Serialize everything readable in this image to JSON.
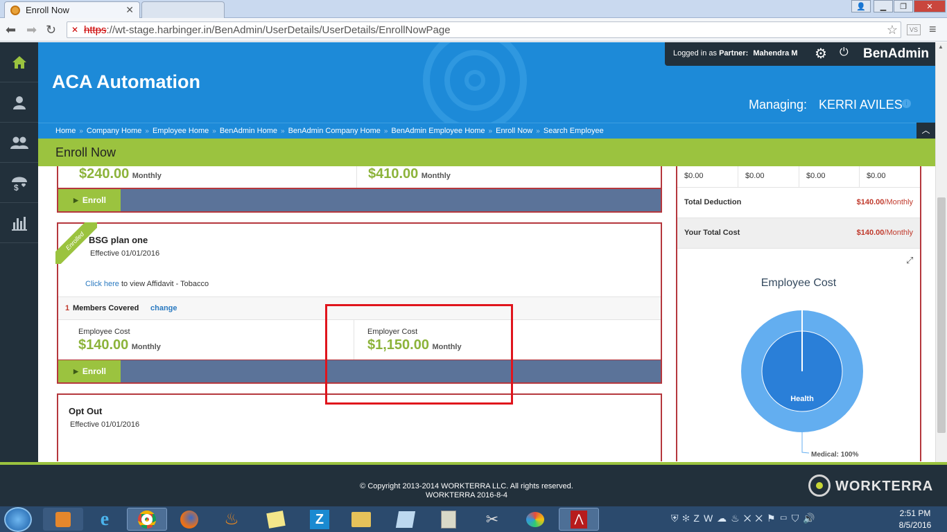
{
  "browser": {
    "tab_title": "Enroll Now",
    "url_prefix": "https",
    "url_rest": "://wt-stage.harbinger.in/BenAdmin/UserDetails/UserDetails/EnrollNowPage"
  },
  "header": {
    "logged_in_prefix": "Logged in as",
    "partner_label": "Partner:",
    "user_name": "Mahendra M",
    "app_name": "BenAdmin",
    "company": "ACA Automation",
    "managing_label": "Managing:",
    "managing_name": "KERRI AVILES"
  },
  "breadcrumbs": [
    "Home",
    "Company Home",
    "Employee Home",
    "BenAdmin Home",
    "BenAdmin Company Home",
    "BenAdmin Employee Home",
    "Enroll Now",
    "Search Employee"
  ],
  "page_title": "Enroll Now",
  "plans": {
    "top_employee_cost": "$240.00",
    "top_employer_cost": "$410.00",
    "monthly": "Monthly",
    "enroll_label": "Enroll",
    "enrolled_ribbon": "Enrolled",
    "plan_name": "BSG plan one",
    "effective": "Effective 01/01/2016",
    "click_here": "Click here",
    "affidavit_text": "to view Affidavit - Tobacco",
    "members_count": "1",
    "members_label": "Members Covered",
    "change_label": "change",
    "employee_cost_label": "Employee Cost",
    "employee_cost": "$140.00",
    "employer_cost_label": "Employer Cost",
    "employer_cost": "$1,150.00",
    "optout_title": "Opt Out",
    "optout_effective": "Effective 01/01/2016"
  },
  "summary": {
    "zero_values": [
      "$0.00",
      "$0.00",
      "$0.00",
      "$0.00"
    ],
    "total_deduction_label": "Total Deduction",
    "total_deduction_value": "$140.00",
    "your_total_cost_label": "Your Total Cost",
    "your_total_cost_value": "$140.00",
    "per_monthly": "/Monthly",
    "chart_title": "Employee Cost",
    "inner_label": "Health",
    "outer_label": "Medical: 100%"
  },
  "chart_data": {
    "type": "pie",
    "title": "Employee Cost",
    "inner": [
      {
        "label": "Health",
        "value": 100
      }
    ],
    "outer": [
      {
        "label": "Medical",
        "value": 100
      }
    ]
  },
  "footer": {
    "copyright": "© Copyright 2013-2014 WORKTERRA LLC. All rights reserved.",
    "version": "WORKTERRA 2016-8-4",
    "brand": "WORKTERRA"
  },
  "taskbar": {
    "time": "2:51 PM",
    "date": "8/5/2016"
  },
  "colors": {
    "brand_blue": "#1d8ad8",
    "green": "#9bc33f",
    "dark": "#22303b",
    "red_border": "#b5373d",
    "highlight_box": "#e0141c"
  }
}
